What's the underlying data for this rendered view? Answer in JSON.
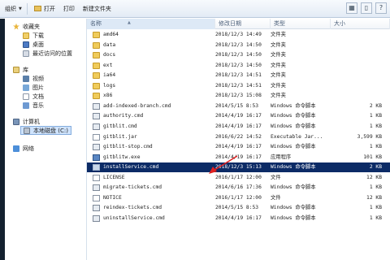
{
  "toolbar": {
    "organize_label": "组织",
    "open_label": "打开",
    "print_label": "打印",
    "new_folder_label": "新建文件夹"
  },
  "nav": {
    "favorites": "收藏夹",
    "favorites_items": [
      "下载",
      "桌面",
      "最近访问的位置"
    ],
    "library": "库",
    "library_items": [
      "视频",
      "图片",
      "文档",
      "音乐"
    ],
    "computer": "计算机",
    "local_disk": "本地磁盘 (C:)",
    "network": "网络"
  },
  "columns": {
    "name": "名称",
    "date": "修改日期",
    "type": "类型",
    "size": "大小"
  },
  "files": [
    {
      "name": "amd64",
      "date": "2018/12/3 14:49",
      "type": "文件夹",
      "size": "",
      "icon": "folder"
    },
    {
      "name": "data",
      "date": "2018/12/3 14:50",
      "type": "文件夹",
      "size": "",
      "icon": "folder"
    },
    {
      "name": "docs",
      "date": "2018/12/3 14:50",
      "type": "文件夹",
      "size": "",
      "icon": "folder"
    },
    {
      "name": "ext",
      "date": "2018/12/3 14:50",
      "type": "文件夹",
      "size": "",
      "icon": "folder"
    },
    {
      "name": "ia64",
      "date": "2018/12/3 14:51",
      "type": "文件夹",
      "size": "",
      "icon": "folder"
    },
    {
      "name": "logs",
      "date": "2018/12/3 14:51",
      "type": "文件夹",
      "size": "",
      "icon": "folder"
    },
    {
      "name": "x86",
      "date": "2018/12/3 15:08",
      "type": "文件夹",
      "size": "",
      "icon": "folder"
    },
    {
      "name": "add-indexed-branch.cmd",
      "date": "2014/5/15 8:53",
      "type": "Windows 命令脚本",
      "size": "2 KB",
      "icon": "cmd"
    },
    {
      "name": "authority.cmd",
      "date": "2014/4/19 16:17",
      "type": "Windows 命令脚本",
      "size": "1 KB",
      "icon": "cmd"
    },
    {
      "name": "gitblit.cmd",
      "date": "2014/4/19 16:17",
      "type": "Windows 命令脚本",
      "size": "1 KB",
      "icon": "cmd"
    },
    {
      "name": "gitblit.jar",
      "date": "2016/6/22 14:52",
      "type": "Executable Jar...",
      "size": "3,599 KB",
      "icon": "file"
    },
    {
      "name": "gitblit-stop.cmd",
      "date": "2014/4/19 16:17",
      "type": "Windows 命令脚本",
      "size": "1 KB",
      "icon": "cmd"
    },
    {
      "name": "gitblitw.exe",
      "date": "2014/4/19 16:17",
      "type": "应用程序",
      "size": "101 KB",
      "icon": "exe"
    },
    {
      "name": "installService.cmd",
      "date": "2018/12/3 15:13",
      "type": "Windows 命令脚本",
      "size": "2 KB",
      "icon": "cmd",
      "selected": true
    },
    {
      "name": "LICENSE",
      "date": "2016/1/17 12:00",
      "type": "文件",
      "size": "12 KB",
      "icon": "file"
    },
    {
      "name": "migrate-tickets.cmd",
      "date": "2014/6/16 17:36",
      "type": "Windows 命令脚本",
      "size": "1 KB",
      "icon": "cmd"
    },
    {
      "name": "NOTICE",
      "date": "2016/1/17 12:00",
      "type": "文件",
      "size": "12 KB",
      "icon": "file"
    },
    {
      "name": "reindex-tickets.cmd",
      "date": "2014/5/15 8:53",
      "type": "Windows 命令脚本",
      "size": "1 KB",
      "icon": "cmd"
    },
    {
      "name": "uninstallService.cmd",
      "date": "2014/4/19 16:17",
      "type": "Windows 命令脚本",
      "size": "1 KB",
      "icon": "cmd"
    }
  ],
  "arrow_color": "#e02020"
}
